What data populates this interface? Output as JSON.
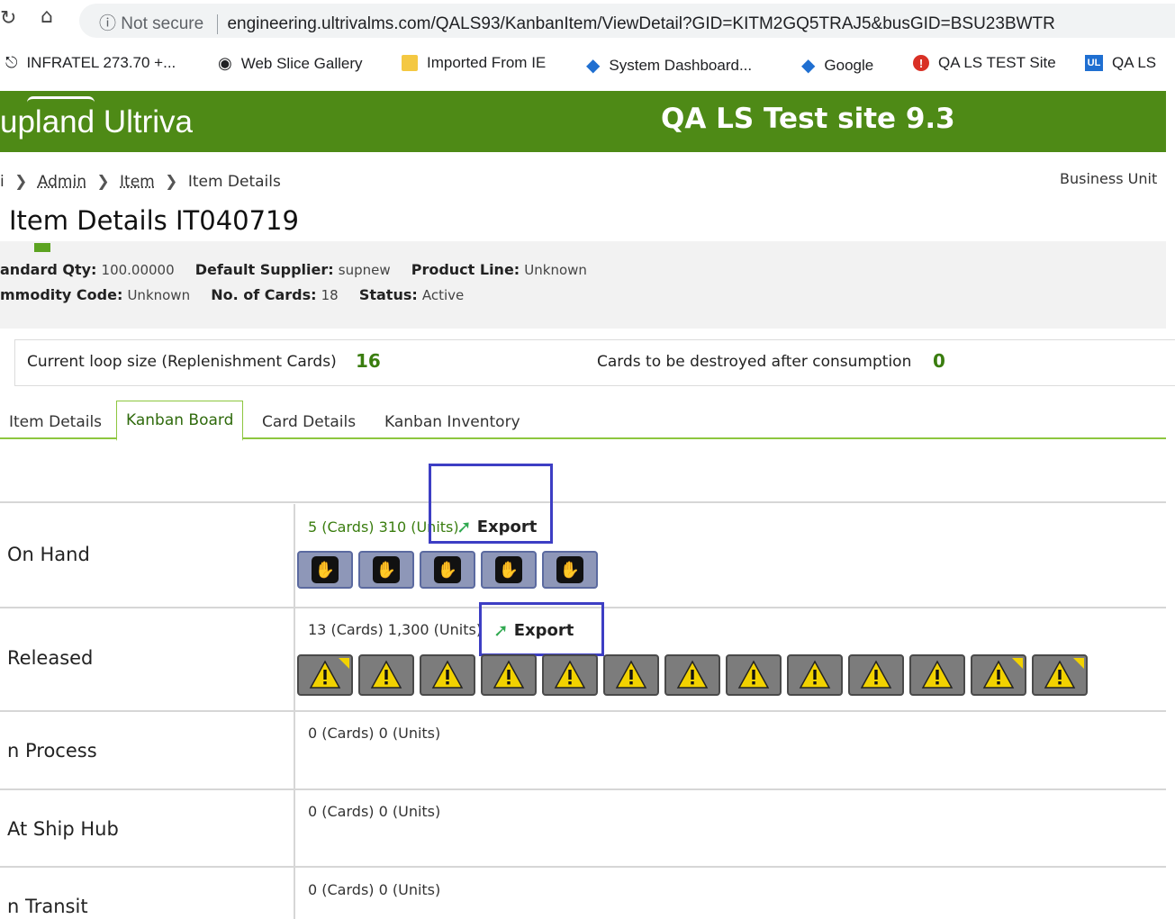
{
  "browser": {
    "security": "Not secure",
    "url": "engineering.ultrivalms.com/QALS93/KanbanItem/ViewDetail?GID=KITM2GQ5TRAJ5&busGID=BSU23BWTR",
    "bookmarks": [
      {
        "label": "INFRATEL 273.70 +..."
      },
      {
        "label": "Web Slice Gallery"
      },
      {
        "label": "Imported From IE"
      },
      {
        "label": "System Dashboard..."
      },
      {
        "label": "Google"
      },
      {
        "label": "QA LS TEST Site"
      },
      {
        "label": "QA LS"
      }
    ]
  },
  "header": {
    "brand": "upland Ultriva",
    "site_title": "QA LS Test site 9.3"
  },
  "breadcrumb": {
    "first": "i",
    "admin": "Admin",
    "item": "Item",
    "current": "Item Details",
    "business_unit": "Business Unit"
  },
  "page": {
    "title": "Item Details IT040719"
  },
  "summary": {
    "standard_qty_label": "andard Qty:",
    "standard_qty": "100.00000",
    "supplier_label": "Default Supplier:",
    "supplier": "supnew",
    "product_line_label": "Product Line:",
    "product_line": "Unknown",
    "commodity_label": "mmodity Code:",
    "commodity": "Unknown",
    "cards_label": "No. of Cards:",
    "cards": "18",
    "status_label": "Status:",
    "status": "Active"
  },
  "loop": {
    "loop_label": "Current loop size (Replenishment Cards)",
    "loop_value": "16",
    "destroy_label": "Cards to be destroyed after consumption",
    "destroy_value": "0"
  },
  "tabs": [
    "Item Details",
    "Kanban Board",
    "Card Details",
    "Kanban Inventory"
  ],
  "lanes": {
    "on_hand": {
      "label": "On Hand",
      "count": "5 (Cards) 310 (Units)",
      "export": "Export",
      "cards": 5
    },
    "released": {
      "label": "Released",
      "count": "13 (Cards) 1,300 (Units)",
      "export": "Export",
      "cards": 13
    },
    "in_process": {
      "label": "n Process",
      "count": "0 (Cards) 0 (Units)"
    },
    "ship_hub": {
      "label": "At Ship Hub",
      "count": "0 (Cards) 0 (Units)"
    },
    "in_transit": {
      "label": "n Transit",
      "count": "0 (Cards) 0 (Units)"
    }
  },
  "colors": {
    "header_green": "#4e8a16",
    "accent_green": "#3a7d0f",
    "highlight_blue": "#3d3ec4",
    "warning_yellow": "#f2d200"
  }
}
